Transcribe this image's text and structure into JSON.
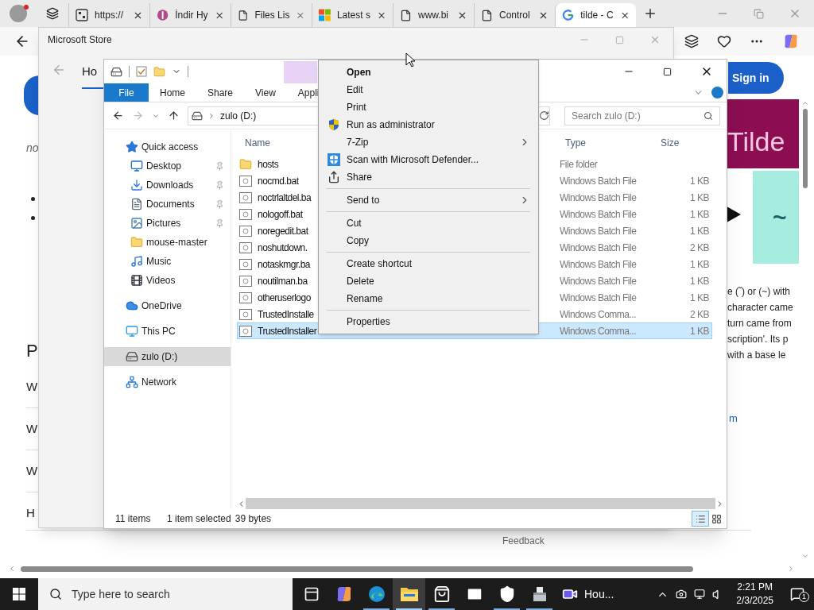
{
  "browser": {
    "tabs": [
      {
        "title": "https://",
        "kind": "code",
        "selected": false
      },
      {
        "title": "İndir Hy",
        "kind": "brand",
        "selected": false
      },
      {
        "title": "Files Lis",
        "kind": "doc",
        "selected": false
      },
      {
        "title": "Latest s",
        "kind": "tiles",
        "selected": false
      },
      {
        "title": "www.bi",
        "kind": "doc",
        "selected": false
      },
      {
        "title": "Control",
        "kind": "doc",
        "selected": false
      },
      {
        "title": "tilde - C",
        "kind": "search",
        "selected": true
      }
    ]
  },
  "page": {
    "sign_in": "Sign in",
    "banner": "Tilde",
    "card_symbol": "~",
    "left_fragments": [
      "no",
      "P",
      "W",
      "W",
      "W",
      "H"
    ],
    "right_lines": [
      "e (˜) or (~) with",
      "character came",
      "turn came from",
      "scription'. Its p",
      "with a base le"
    ],
    "link_fragment": "m",
    "feedback": "Feedback"
  },
  "store": {
    "title": "Microsoft Store",
    "nav": "Ho"
  },
  "explorer": {
    "ribbon_tabs": [
      {
        "label": "File",
        "selected": true
      },
      {
        "label": "Home",
        "selected": false
      },
      {
        "label": "Share",
        "selected": false
      },
      {
        "label": "View",
        "selected": false
      },
      {
        "label": "Appli",
        "selected": false
      }
    ],
    "address": "zulo (D:)",
    "search_placeholder": "Search zulo (D:)",
    "nav": [
      {
        "label": "Quick access",
        "kind": "star",
        "pinned": false,
        "selected": false,
        "children": [
          {
            "label": "Desktop",
            "kind": "desktop",
            "pinned": true,
            "selected": false
          },
          {
            "label": "Downloads",
            "kind": "download",
            "pinned": true,
            "selected": false
          },
          {
            "label": "Documents",
            "kind": "document",
            "pinned": true,
            "selected": false
          },
          {
            "label": "Pictures",
            "kind": "picture",
            "pinned": true,
            "selected": false
          },
          {
            "label": "mouse-master",
            "kind": "folder",
            "pinned": false,
            "selected": false
          },
          {
            "label": "Music",
            "kind": "music",
            "pinned": false,
            "selected": false
          },
          {
            "label": "Videos",
            "kind": "video",
            "pinned": false,
            "selected": false
          }
        ]
      },
      {
        "label": "OneDrive",
        "kind": "cloud",
        "pinned": false,
        "selected": false
      },
      {
        "label": "This PC",
        "kind": "pc",
        "pinned": false,
        "selected": false
      },
      {
        "label": "zulo (D:)",
        "kind": "drive",
        "pinned": false,
        "selected": true
      },
      {
        "label": "Network",
        "kind": "network",
        "pinned": false,
        "selected": false
      }
    ],
    "columns": [
      "Name",
      "Type",
      "Size"
    ],
    "rows": [
      {
        "name": "hosts",
        "kind": "folder",
        "type": "File folder",
        "size": "",
        "selected": false
      },
      {
        "name": "nocmd.bat",
        "kind": "file",
        "type": "Windows Batch File",
        "size": "1 KB",
        "selected": false
      },
      {
        "name": "noctrlaltdel.ba",
        "kind": "file",
        "type": "Windows Batch File",
        "size": "1 KB",
        "selected": false
      },
      {
        "name": "nologoff.bat",
        "kind": "file",
        "type": "Windows Batch File",
        "size": "1 KB",
        "selected": false
      },
      {
        "name": "noregedit.bat",
        "kind": "file",
        "type": "Windows Batch File",
        "size": "1 KB",
        "selected": false
      },
      {
        "name": "noshutdown.",
        "kind": "file",
        "type": "Windows Batch File",
        "size": "2 KB",
        "selected": false
      },
      {
        "name": "notaskmgr.ba",
        "kind": "file",
        "type": "Windows Batch File",
        "size": "1 KB",
        "selected": false
      },
      {
        "name": "noutilman.ba",
        "kind": "file",
        "type": "Windows Batch File",
        "size": "1 KB",
        "selected": false
      },
      {
        "name": "otheruserlogo",
        "kind": "file",
        "type": "Windows Batch File",
        "size": "1 KB",
        "selected": false
      },
      {
        "name": "TrustedInstalle",
        "kind": "file",
        "type": "Windows Comma...",
        "size": "2 KB",
        "selected": false
      },
      {
        "name": "TrustedInstaller",
        "kind": "file",
        "type": "Windows Comma...",
        "size": "1 KB",
        "selected": true
      }
    ],
    "status": [
      "11 items",
      "1 item selected",
      "39 bytes"
    ]
  },
  "context_menu": [
    {
      "kind": "default",
      "label": "Open"
    },
    {
      "kind": "item",
      "label": "Edit"
    },
    {
      "kind": "item",
      "label": "Print"
    },
    {
      "kind": "admin",
      "label": "Run as administrator"
    },
    {
      "kind": "submenu",
      "label": "7-Zip"
    },
    {
      "kind": "scan",
      "label": "Scan with Microsoft Defender..."
    },
    {
      "kind": "share",
      "label": "Share"
    },
    {
      "kind": "separator"
    },
    {
      "kind": "submenu",
      "label": "Send to"
    },
    {
      "kind": "separator"
    },
    {
      "kind": "item",
      "label": "Cut"
    },
    {
      "kind": "item",
      "label": "Copy"
    },
    {
      "kind": "separator"
    },
    {
      "kind": "item",
      "label": "Create shortcut"
    },
    {
      "kind": "item",
      "label": "Delete"
    },
    {
      "kind": "item",
      "label": "Rename"
    },
    {
      "kind": "separator"
    },
    {
      "kind": "item",
      "label": "Properties"
    }
  ],
  "taskbar": {
    "search_placeholder": "Type here to search",
    "apps": [
      {
        "kind": "taskview",
        "open": false,
        "selected": false
      },
      {
        "kind": "copilot",
        "open": false,
        "selected": false
      },
      {
        "kind": "edge",
        "open": true,
        "selected": false
      },
      {
        "kind": "explorer",
        "open": true,
        "selected": true
      },
      {
        "kind": "store",
        "open": true,
        "selected": false
      },
      {
        "kind": "mail",
        "open": false,
        "selected": false
      },
      {
        "kind": "security",
        "open": true,
        "selected": false
      },
      {
        "kind": "installer",
        "open": true,
        "selected": false
      },
      {
        "kind": "video",
        "open": false,
        "selected": false,
        "label": "Hou..."
      }
    ],
    "time": "2:21 PM",
    "date": "2/3/2025",
    "notifications": "1"
  }
}
